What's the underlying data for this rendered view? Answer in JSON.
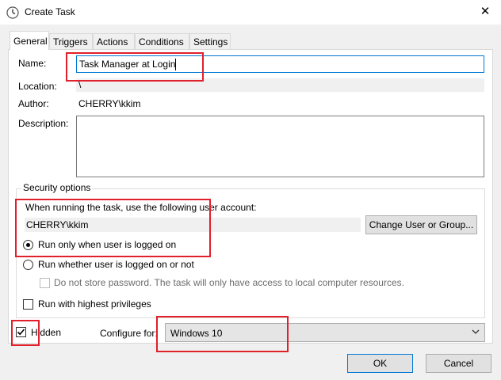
{
  "window": {
    "title": "Create Task",
    "close_glyph": "✕"
  },
  "tabs": [
    "General",
    "Triggers",
    "Actions",
    "Conditions",
    "Settings"
  ],
  "general": {
    "name_label": "Name:",
    "name_value": "Task Manager at Login",
    "location_label": "Location:",
    "location_value": "\\",
    "author_label": "Author:",
    "author_value": "CHERRY\\kkim",
    "description_label": "Description:",
    "description_value": ""
  },
  "security": {
    "title": "Security options",
    "account_prompt": "When running the task, use the following user account:",
    "account_value": "CHERRY\\kkim",
    "change_button": "Change User or Group...",
    "radio_logged_on": "Run only when user is logged on",
    "radio_whether": "Run whether user is logged on or not",
    "no_store_password": "Do not store password.  The task will only have access to local computer resources.",
    "highest_privileges": "Run with highest privileges"
  },
  "bottom": {
    "hidden_label": "Hidden",
    "configure_label": "Configure for:",
    "configure_value": "Windows 10"
  },
  "buttons": {
    "ok": "OK",
    "cancel": "Cancel"
  },
  "state": {
    "selected_radio": "logged_on",
    "hidden_checked": true,
    "highest_checked": false,
    "no_store_checked": false
  }
}
